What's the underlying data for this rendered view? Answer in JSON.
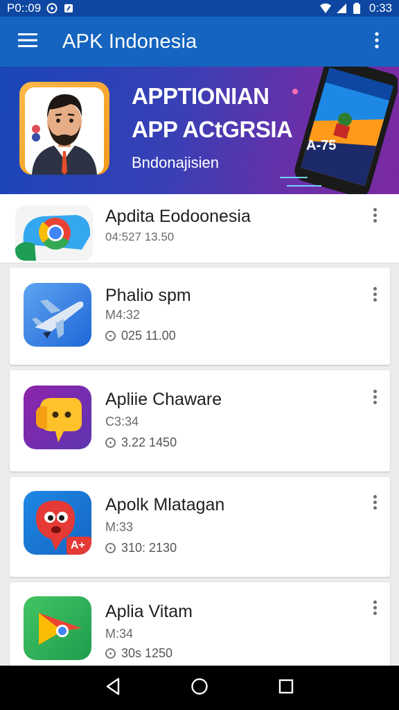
{
  "status_bar": {
    "left_text": "P0::09",
    "time": "0:33",
    "icons": [
      "play-circle-icon",
      "notification-icon",
      "wifi-icon",
      "signal-icon",
      "battery-icon"
    ]
  },
  "app_bar": {
    "title": "APK Indonesia",
    "menu_icon": "hamburger-menu-icon",
    "overflow_icon": "more-vert-icon"
  },
  "banner": {
    "title_line1": "APPTIONIAN",
    "title_line2": "APP ACtGRSIA",
    "subtitle": "Bndonajisien",
    "phone_label": "A-75"
  },
  "apps": [
    {
      "name": "Apdita Eodoonesia",
      "meta": "",
      "size": "04:527 13.50",
      "icon": "chrome-icon"
    },
    {
      "name": "Phalio spm",
      "meta": "M4:32",
      "size": "025 11.00",
      "icon": "plane-app-icon"
    },
    {
      "name": "Apliie Chaware",
      "meta": "C3:34",
      "size": "3.22 1450",
      "icon": "chat-emoji-app-icon"
    },
    {
      "name": "Apolk Mlatagan",
      "meta": "M:33",
      "size": "310: 2130",
      "icon": "red-monster-app-icon",
      "badge": "A+"
    },
    {
      "name": "Aplia Vitam",
      "meta": "M:34",
      "size": "30s 1250",
      "icon": "play-store-icon"
    }
  ],
  "colors": {
    "status_bar": "#0d47a1",
    "app_bar": "#1565c0",
    "background": "#ececec"
  }
}
